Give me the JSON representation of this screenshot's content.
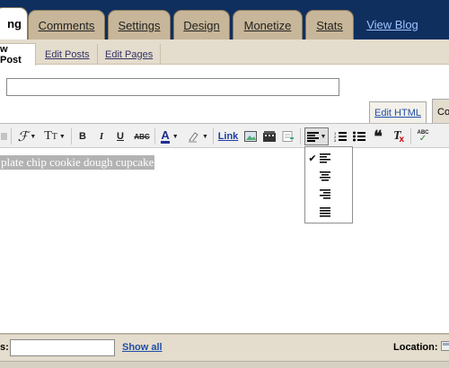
{
  "top_tabs": [
    {
      "label": "ng",
      "active": true
    },
    {
      "label": "Comments"
    },
    {
      "label": "Settings"
    },
    {
      "label": "Design"
    },
    {
      "label": "Monetize"
    },
    {
      "label": "Stats"
    }
  ],
  "view_blog": "View Blog",
  "sub_tabs": {
    "new_post": "w Post",
    "edit_posts": "Edit Posts",
    "edit_pages": "Edit Pages"
  },
  "title_input": {
    "value": ""
  },
  "mode_tabs": {
    "edit_html": "Edit HTML",
    "compose": "Co"
  },
  "toolbar": {
    "font_icon": "font-icon",
    "text_size_icon": "text-size-icon",
    "bold": "B",
    "italic": "I",
    "underline": "U",
    "strikethrough": "ABC",
    "text_color": "A",
    "link": "Link",
    "spell_check": "ABC"
  },
  "editor": {
    "body_text": "plate chip cookie dough cupcake"
  },
  "align_menu": {
    "options": [
      "align-left",
      "align-center",
      "align-right",
      "align-justify"
    ],
    "selected": "align-left"
  },
  "footer": {
    "labels_label": "s:",
    "labels_value": "",
    "show_all": "Show all",
    "location_label": "Location:"
  },
  "colors": {
    "header_bg": "#0f2f5f",
    "tab_bg": "#c7b699",
    "panel_bg": "#e4dccc",
    "link": "#1f4ea8"
  }
}
